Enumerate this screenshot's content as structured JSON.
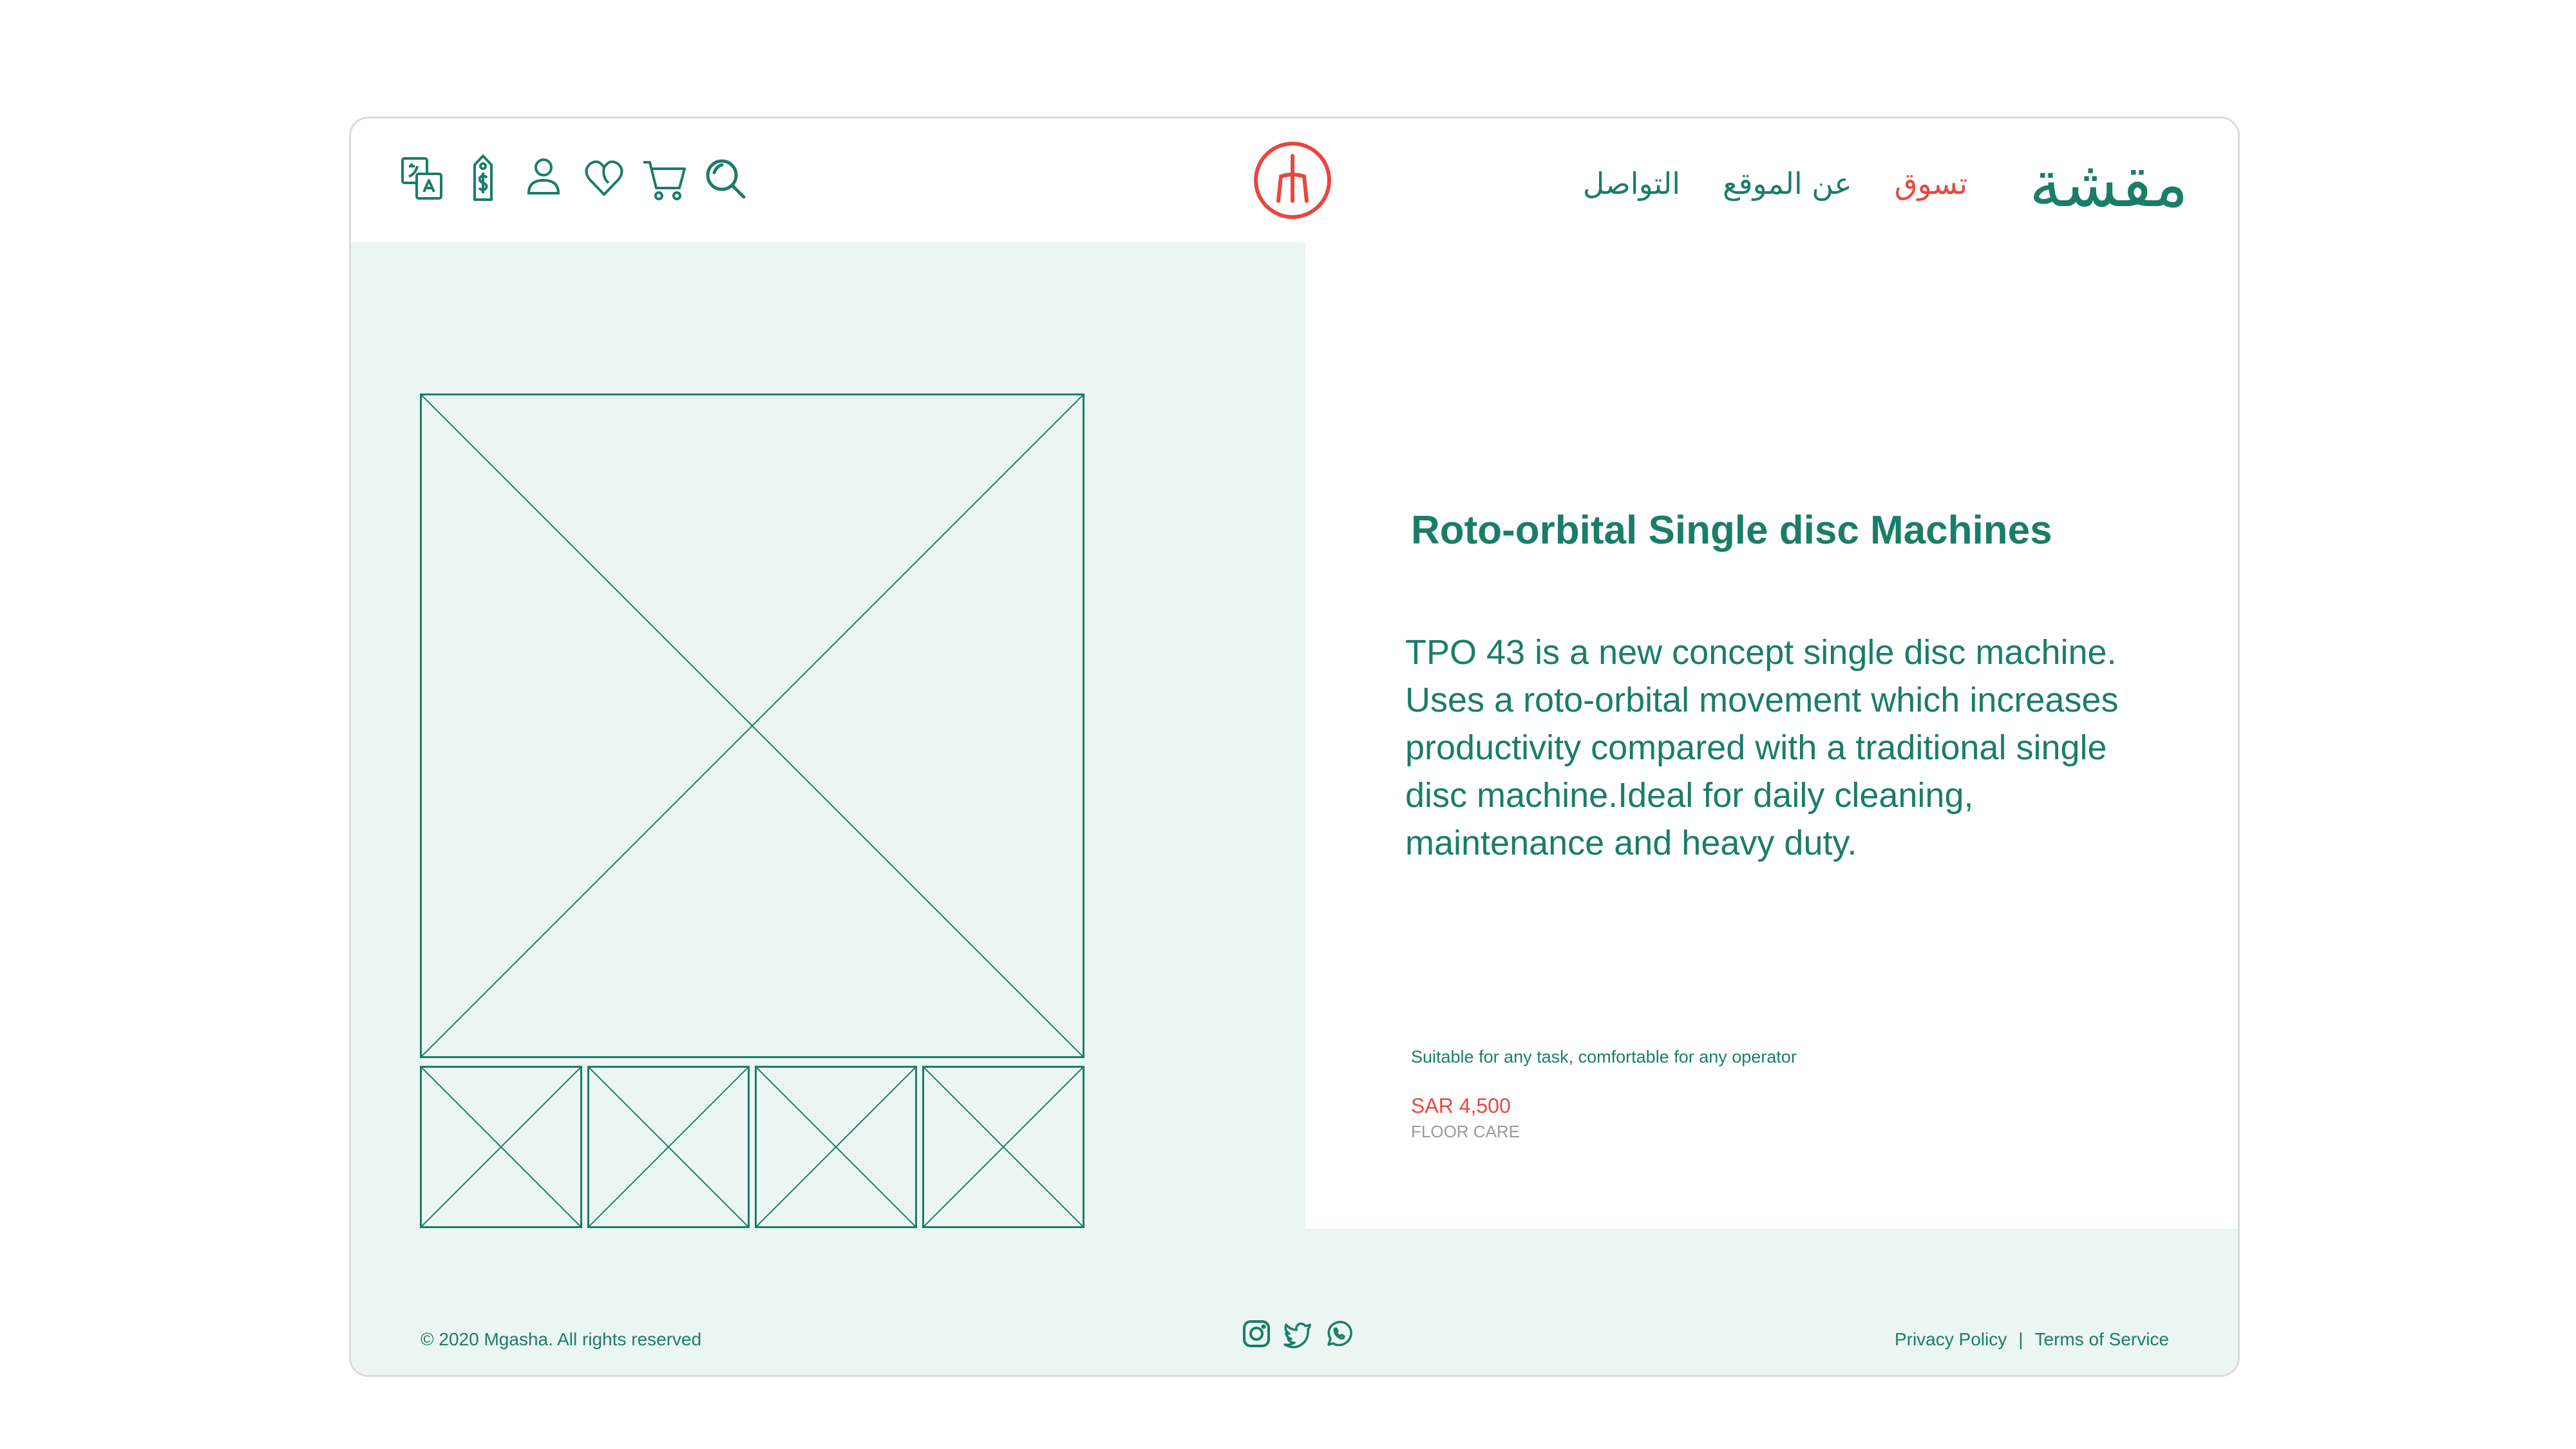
{
  "colors": {
    "brand": "#1a7d68",
    "accent": "#e8473e",
    "panel": "#ebf5f2",
    "muted": "#9a9a9a"
  },
  "header": {
    "icons": [
      "translate-icon",
      "price-tag-icon",
      "user-icon",
      "wishlist-heart-icon",
      "cart-icon",
      "search-icon"
    ],
    "brand_logo": "مقشة",
    "nav": {
      "shop": "تسوق",
      "about": "عن الموقع",
      "contact": "التواصل"
    }
  },
  "product": {
    "title": "Roto-orbital Single disc Machines",
    "description": "TPO 43 is a new concept single disc machine. Uses a roto-orbital movement which increases productivity compared with a traditional single disc machine.Ideal for daily cleaning, maintenance and heavy duty.",
    "tagline": "Suitable for any task, comfortable for any  operator",
    "price": "SAR 4,500",
    "category": "FLOOR CARE",
    "thumbnail_count": 4
  },
  "footer": {
    "copyright": "© 2020 Mgasha. All rights reserved",
    "social_icons": [
      "instagram-icon",
      "twitter-icon",
      "whatsapp-icon"
    ],
    "privacy": "Privacy Policy",
    "separator": "|",
    "terms": "Terms of Service"
  }
}
